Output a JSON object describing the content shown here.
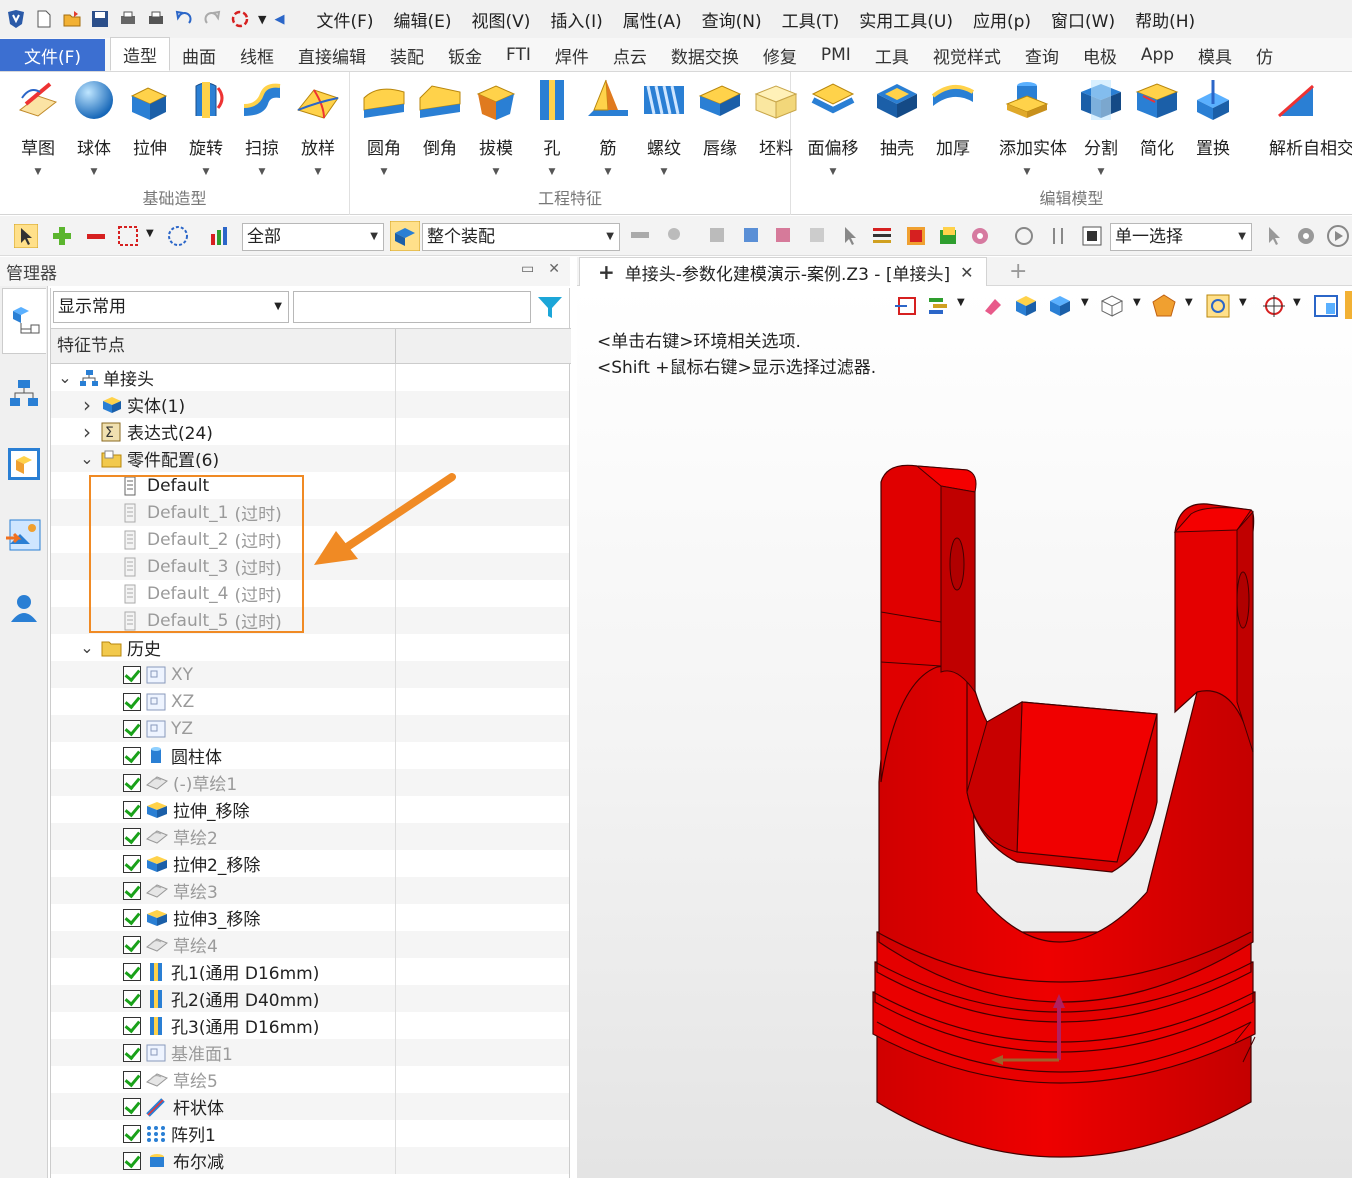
{
  "menu": [
    "文件(F)",
    "编辑(E)",
    "视图(V)",
    "插入(I)",
    "属性(A)",
    "查询(N)",
    "工具(T)",
    "实用工具(U)",
    "应用(p)",
    "窗口(W)",
    "帮助(H)"
  ],
  "ribbon_tabs": {
    "file": "文件(F)",
    "items": [
      "造型",
      "曲面",
      "线框",
      "直接编辑",
      "装配",
      "钣金",
      "FTI",
      "焊件",
      "点云",
      "数据交换",
      "修复",
      "PMI",
      "工具",
      "视觉样式",
      "查询",
      "电极",
      "App",
      "模具",
      "仿"
    ],
    "active": "造型"
  },
  "ribbon": {
    "groups": [
      {
        "title": "基础造型",
        "buttons": [
          "草图",
          "球体",
          "拉伸",
          "旋转",
          "扫掠",
          "放样"
        ]
      },
      {
        "title": "工程特征",
        "buttons": [
          "圆角",
          "倒角",
          "拔模",
          "孔",
          "筋",
          "螺纹",
          "唇缘",
          "坯料"
        ]
      },
      {
        "title": "编辑模型",
        "buttons": [
          "面偏移",
          "抽壳",
          "加厚",
          "添加实体",
          "分割",
          "简化",
          "置换",
          "解析自相交"
        ]
      }
    ]
  },
  "toolbar": {
    "filter_value": "全部",
    "assembly_value": "整个装配",
    "select_mode": "单一选择"
  },
  "manager": {
    "title": "管理器",
    "display_filter": "显示常用",
    "search_placeholder": "",
    "column_header": "特征节点"
  },
  "tree": {
    "root": "单接头",
    "solid": "实体(1)",
    "expressions": "表达式(24)",
    "configs_label": "零件配置(6)",
    "configs": [
      {
        "name": "Default",
        "suffix": ""
      },
      {
        "name": "Default_1",
        "suffix": "(过时)"
      },
      {
        "name": "Default_2",
        "suffix": "(过时)"
      },
      {
        "name": "Default_3",
        "suffix": "(过时)"
      },
      {
        "name": "Default_4",
        "suffix": "(过时)"
      },
      {
        "name": "Default_5",
        "suffix": "(过时)"
      }
    ],
    "history_label": "历史",
    "history": [
      {
        "name": "XY",
        "dim": true,
        "icon": "datum-plane-icon"
      },
      {
        "name": "XZ",
        "dim": true,
        "icon": "datum-plane-icon"
      },
      {
        "name": "YZ",
        "dim": true,
        "icon": "datum-plane-icon"
      },
      {
        "name": "圆柱体",
        "dim": false,
        "icon": "cylinder-icon"
      },
      {
        "name": "(-)草绘1",
        "dim": true,
        "icon": "sketch-icon"
      },
      {
        "name": "拉伸_移除",
        "dim": false,
        "icon": "extrude-icon"
      },
      {
        "name": "草绘2",
        "dim": true,
        "icon": "sketch-icon"
      },
      {
        "name": "拉伸2_移除",
        "dim": false,
        "icon": "extrude-icon"
      },
      {
        "name": "草绘3",
        "dim": true,
        "icon": "sketch-icon"
      },
      {
        "name": "拉伸3_移除",
        "dim": false,
        "icon": "extrude-icon"
      },
      {
        "name": "草绘4",
        "dim": true,
        "icon": "sketch-icon"
      },
      {
        "name": "孔1(通用 D16mm)",
        "dim": false,
        "icon": "hole-icon"
      },
      {
        "name": "孔2(通用 D40mm)",
        "dim": false,
        "icon": "hole-icon"
      },
      {
        "name": "孔3(通用 D16mm)",
        "dim": false,
        "icon": "hole-icon"
      },
      {
        "name": "基准面1",
        "dim": true,
        "icon": "datum-plane-icon"
      },
      {
        "name": "草绘5",
        "dim": true,
        "icon": "sketch-icon"
      },
      {
        "name": "杆状体",
        "dim": false,
        "icon": "rod-icon"
      },
      {
        "name": "阵列1",
        "dim": false,
        "icon": "pattern-icon"
      },
      {
        "name": "布尔减",
        "dim": false,
        "icon": "boolean-icon"
      }
    ]
  },
  "document": {
    "tab_title": "单接头-参数化建模演示-案例.Z3 - [单接头]"
  },
  "viewport": {
    "hint_line1": "<单击右键>环境相关选项.",
    "hint_line2": "<Shift +鼠标右键>显示选择过滤器."
  },
  "colors": {
    "accent": "#3c6fd1",
    "model": "#e30000",
    "highlight": "#f08a24"
  }
}
